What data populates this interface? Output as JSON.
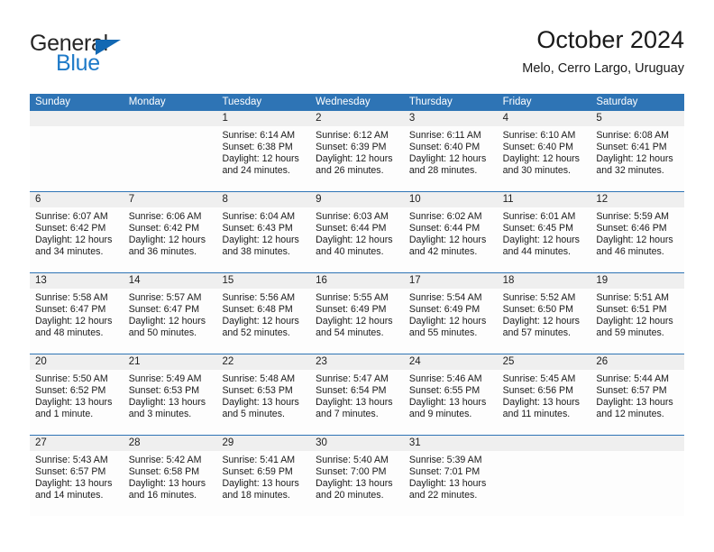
{
  "brand": {
    "name_top": "General",
    "name_bottom": "Blue",
    "color_top": "#262626",
    "color_bottom": "#1e7ac8",
    "triangle_color": "#1268b3"
  },
  "header": {
    "title": "October 2024",
    "location": "Melo, Cerro Largo, Uruguay"
  },
  "theme": {
    "header_bar": "#2e74b5",
    "week_rule": "#2e74b5",
    "daynum_band": "#efefef",
    "cell_bg": "#fdfdfd",
    "text": "#1a1a1a"
  },
  "weekdays": [
    "Sunday",
    "Monday",
    "Tuesday",
    "Wednesday",
    "Thursday",
    "Friday",
    "Saturday"
  ],
  "weeks": [
    [
      {
        "day": "",
        "sunrise": "",
        "sunset": "",
        "daylight1": "",
        "daylight2": ""
      },
      {
        "day": "",
        "sunrise": "",
        "sunset": "",
        "daylight1": "",
        "daylight2": ""
      },
      {
        "day": "1",
        "sunrise": "Sunrise: 6:14 AM",
        "sunset": "Sunset: 6:38 PM",
        "daylight1": "Daylight: 12 hours",
        "daylight2": "and 24 minutes."
      },
      {
        "day": "2",
        "sunrise": "Sunrise: 6:12 AM",
        "sunset": "Sunset: 6:39 PM",
        "daylight1": "Daylight: 12 hours",
        "daylight2": "and 26 minutes."
      },
      {
        "day": "3",
        "sunrise": "Sunrise: 6:11 AM",
        "sunset": "Sunset: 6:40 PM",
        "daylight1": "Daylight: 12 hours",
        "daylight2": "and 28 minutes."
      },
      {
        "day": "4",
        "sunrise": "Sunrise: 6:10 AM",
        "sunset": "Sunset: 6:40 PM",
        "daylight1": "Daylight: 12 hours",
        "daylight2": "and 30 minutes."
      },
      {
        "day": "5",
        "sunrise": "Sunrise: 6:08 AM",
        "sunset": "Sunset: 6:41 PM",
        "daylight1": "Daylight: 12 hours",
        "daylight2": "and 32 minutes."
      }
    ],
    [
      {
        "day": "6",
        "sunrise": "Sunrise: 6:07 AM",
        "sunset": "Sunset: 6:42 PM",
        "daylight1": "Daylight: 12 hours",
        "daylight2": "and 34 minutes."
      },
      {
        "day": "7",
        "sunrise": "Sunrise: 6:06 AM",
        "sunset": "Sunset: 6:42 PM",
        "daylight1": "Daylight: 12 hours",
        "daylight2": "and 36 minutes."
      },
      {
        "day": "8",
        "sunrise": "Sunrise: 6:04 AM",
        "sunset": "Sunset: 6:43 PM",
        "daylight1": "Daylight: 12 hours",
        "daylight2": "and 38 minutes."
      },
      {
        "day": "9",
        "sunrise": "Sunrise: 6:03 AM",
        "sunset": "Sunset: 6:44 PM",
        "daylight1": "Daylight: 12 hours",
        "daylight2": "and 40 minutes."
      },
      {
        "day": "10",
        "sunrise": "Sunrise: 6:02 AM",
        "sunset": "Sunset: 6:44 PM",
        "daylight1": "Daylight: 12 hours",
        "daylight2": "and 42 minutes."
      },
      {
        "day": "11",
        "sunrise": "Sunrise: 6:01 AM",
        "sunset": "Sunset: 6:45 PM",
        "daylight1": "Daylight: 12 hours",
        "daylight2": "and 44 minutes."
      },
      {
        "day": "12",
        "sunrise": "Sunrise: 5:59 AM",
        "sunset": "Sunset: 6:46 PM",
        "daylight1": "Daylight: 12 hours",
        "daylight2": "and 46 minutes."
      }
    ],
    [
      {
        "day": "13",
        "sunrise": "Sunrise: 5:58 AM",
        "sunset": "Sunset: 6:47 PM",
        "daylight1": "Daylight: 12 hours",
        "daylight2": "and 48 minutes."
      },
      {
        "day": "14",
        "sunrise": "Sunrise: 5:57 AM",
        "sunset": "Sunset: 6:47 PM",
        "daylight1": "Daylight: 12 hours",
        "daylight2": "and 50 minutes."
      },
      {
        "day": "15",
        "sunrise": "Sunrise: 5:56 AM",
        "sunset": "Sunset: 6:48 PM",
        "daylight1": "Daylight: 12 hours",
        "daylight2": "and 52 minutes."
      },
      {
        "day": "16",
        "sunrise": "Sunrise: 5:55 AM",
        "sunset": "Sunset: 6:49 PM",
        "daylight1": "Daylight: 12 hours",
        "daylight2": "and 54 minutes."
      },
      {
        "day": "17",
        "sunrise": "Sunrise: 5:54 AM",
        "sunset": "Sunset: 6:49 PM",
        "daylight1": "Daylight: 12 hours",
        "daylight2": "and 55 minutes."
      },
      {
        "day": "18",
        "sunrise": "Sunrise: 5:52 AM",
        "sunset": "Sunset: 6:50 PM",
        "daylight1": "Daylight: 12 hours",
        "daylight2": "and 57 minutes."
      },
      {
        "day": "19",
        "sunrise": "Sunrise: 5:51 AM",
        "sunset": "Sunset: 6:51 PM",
        "daylight1": "Daylight: 12 hours",
        "daylight2": "and 59 minutes."
      }
    ],
    [
      {
        "day": "20",
        "sunrise": "Sunrise: 5:50 AM",
        "sunset": "Sunset: 6:52 PM",
        "daylight1": "Daylight: 13 hours",
        "daylight2": "and 1 minute."
      },
      {
        "day": "21",
        "sunrise": "Sunrise: 5:49 AM",
        "sunset": "Sunset: 6:53 PM",
        "daylight1": "Daylight: 13 hours",
        "daylight2": "and 3 minutes."
      },
      {
        "day": "22",
        "sunrise": "Sunrise: 5:48 AM",
        "sunset": "Sunset: 6:53 PM",
        "daylight1": "Daylight: 13 hours",
        "daylight2": "and 5 minutes."
      },
      {
        "day": "23",
        "sunrise": "Sunrise: 5:47 AM",
        "sunset": "Sunset: 6:54 PM",
        "daylight1": "Daylight: 13 hours",
        "daylight2": "and 7 minutes."
      },
      {
        "day": "24",
        "sunrise": "Sunrise: 5:46 AM",
        "sunset": "Sunset: 6:55 PM",
        "daylight1": "Daylight: 13 hours",
        "daylight2": "and 9 minutes."
      },
      {
        "day": "25",
        "sunrise": "Sunrise: 5:45 AM",
        "sunset": "Sunset: 6:56 PM",
        "daylight1": "Daylight: 13 hours",
        "daylight2": "and 11 minutes."
      },
      {
        "day": "26",
        "sunrise": "Sunrise: 5:44 AM",
        "sunset": "Sunset: 6:57 PM",
        "daylight1": "Daylight: 13 hours",
        "daylight2": "and 12 minutes."
      }
    ],
    [
      {
        "day": "27",
        "sunrise": "Sunrise: 5:43 AM",
        "sunset": "Sunset: 6:57 PM",
        "daylight1": "Daylight: 13 hours",
        "daylight2": "and 14 minutes."
      },
      {
        "day": "28",
        "sunrise": "Sunrise: 5:42 AM",
        "sunset": "Sunset: 6:58 PM",
        "daylight1": "Daylight: 13 hours",
        "daylight2": "and 16 minutes."
      },
      {
        "day": "29",
        "sunrise": "Sunrise: 5:41 AM",
        "sunset": "Sunset: 6:59 PM",
        "daylight1": "Daylight: 13 hours",
        "daylight2": "and 18 minutes."
      },
      {
        "day": "30",
        "sunrise": "Sunrise: 5:40 AM",
        "sunset": "Sunset: 7:00 PM",
        "daylight1": "Daylight: 13 hours",
        "daylight2": "and 20 minutes."
      },
      {
        "day": "31",
        "sunrise": "Sunrise: 5:39 AM",
        "sunset": "Sunset: 7:01 PM",
        "daylight1": "Daylight: 13 hours",
        "daylight2": "and 22 minutes."
      },
      {
        "day": "",
        "sunrise": "",
        "sunset": "",
        "daylight1": "",
        "daylight2": ""
      },
      {
        "day": "",
        "sunrise": "",
        "sunset": "",
        "daylight1": "",
        "daylight2": ""
      }
    ]
  ]
}
